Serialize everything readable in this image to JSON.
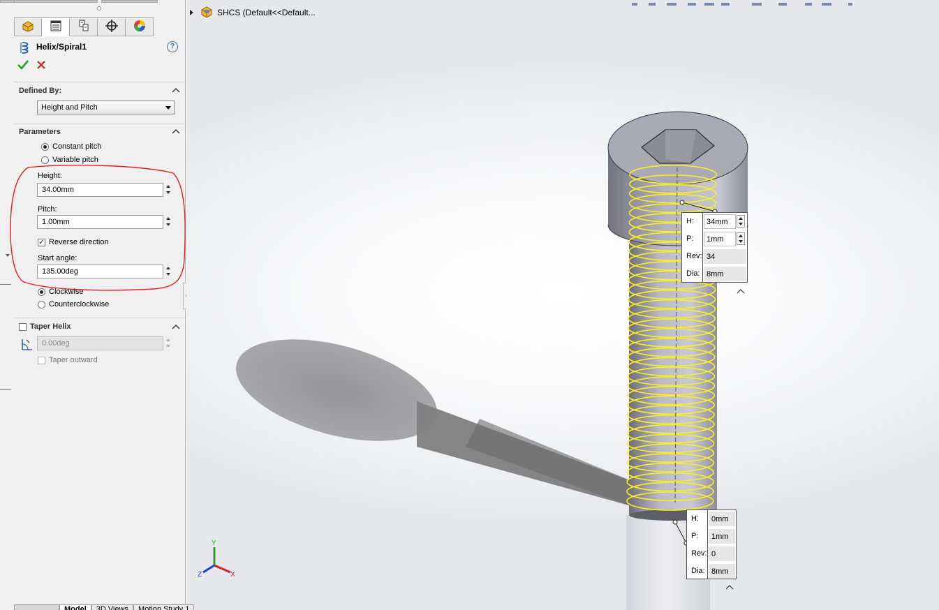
{
  "property_manager": {
    "tabs": [
      {
        "name": "feature-manager",
        "icon": "feature-tree-icon"
      },
      {
        "name": "property-manager",
        "icon": "property-manager-icon"
      },
      {
        "name": "configuration-manager",
        "icon": "configuration-icon"
      },
      {
        "name": "dimxpert-manager",
        "icon": "dimxpert-icon"
      },
      {
        "name": "display-manager",
        "icon": "appearance-icon"
      }
    ],
    "active_tab": 1,
    "title": "Helix/Spiral1",
    "help_label": "?",
    "defined_by": {
      "title": "Defined By:",
      "selected": "Height and Pitch"
    },
    "parameters": {
      "title": "Parameters",
      "pitch_options": [
        {
          "label": "Constant pitch",
          "selected": true
        },
        {
          "label": "Variable pitch",
          "selected": false
        }
      ],
      "height_label": "Height:",
      "height_value": "34.00mm",
      "pitch_label": "Pitch:",
      "pitch_value": "1.00mm",
      "reverse_direction_label": "Reverse direction",
      "reverse_direction_checked": true,
      "start_angle_label": "Start angle:",
      "start_angle_value": "135.00deg",
      "direction_options": [
        {
          "label": "Clockwise",
          "selected": true
        },
        {
          "label": "Counterclockwise",
          "selected": false
        }
      ]
    },
    "taper": {
      "title": "Taper Helix",
      "checked": false,
      "angle_value": "0.00deg",
      "outward_label": "Taper outward",
      "outward_checked": false
    }
  },
  "viewport": {
    "tree_item": "SHCS  (Default<<Default...",
    "helix_color": "#f5ef2a",
    "annotation_color": "#e02020",
    "top_callout": {
      "rows": [
        {
          "label": "H:",
          "value": "34mm",
          "spinner": true
        },
        {
          "label": "P:",
          "value": "1mm",
          "spinner": true
        },
        {
          "label": "Rev:",
          "value": "34",
          "spinner": false
        },
        {
          "label": "Dia:",
          "value": "8mm",
          "spinner": false
        }
      ]
    },
    "bottom_callout": {
      "rows": [
        {
          "label": "H:",
          "value": "0mm"
        },
        {
          "label": "P:",
          "value": "1mm"
        },
        {
          "label": "Rev:",
          "value": "0"
        },
        {
          "label": "Dia:",
          "value": "8mm"
        }
      ]
    },
    "triad_labels": {
      "x": "X",
      "y": "Y",
      "z": "Z"
    }
  },
  "bottom_tabs": [
    "Model",
    "3D Views",
    "Motion Study 1"
  ]
}
